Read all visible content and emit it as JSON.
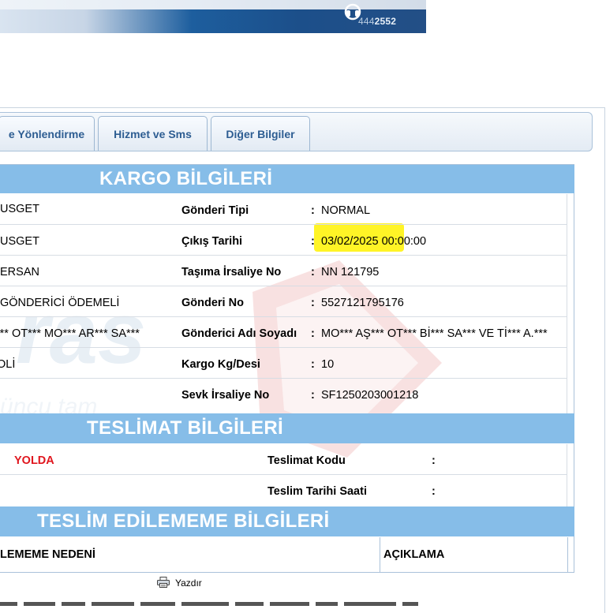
{
  "banner": {
    "phone_prefix": "444",
    "phone_suffix": "2552"
  },
  "tabs": [
    {
      "label": "e Yönlendirme"
    },
    {
      "label": "Hizmet ve Sms"
    },
    {
      "label": "Diğer Bilgiler"
    }
  ],
  "kargo": {
    "title": "KARGO BİLGİLERİ",
    "rows": [
      {
        "left": "USGET",
        "label": "Gönderi Tipi",
        "value": "NORMAL"
      },
      {
        "left": "USGET",
        "label": "Çıkış Tarihi",
        "value": "03/02/2025 00:00:00"
      },
      {
        "left": "ERSAN",
        "label": "Taşıma İrsaliye No",
        "value": "NN 121795"
      },
      {
        "left": "GÖNDERİCİ ÖDEMELİ",
        "label": "Gönderi No",
        "value": "5527121795176"
      },
      {
        "left": "*** OT*** MO*** AR*** SA***",
        "label": "Gönderici Adı Soyadı",
        "value": "MO*** AŞ*** OT*** Bİ*** SA*** VE Tİ*** A.***"
      },
      {
        "left": "OLİ",
        "label": "Kargo Kg/Desi",
        "value": "10"
      },
      {
        "left": "",
        "label": "Sevk İrsaliye No",
        "value": "SF1250203001218"
      }
    ],
    "colon": ":"
  },
  "teslimat": {
    "title": "TESLİMAT BİLGİLERİ",
    "status": "YOLDA",
    "code_label": "Teslimat Kodu",
    "date_label": "Teslim Tarihi Saati",
    "colon": ":"
  },
  "edilememe": {
    "title": "TESLİM EDİLEMEME BİLGİLERİ",
    "reason_header": "LEMEME NEDENİ",
    "desc_header": "AÇIKLAMA"
  },
  "print_label": "Yazdır",
  "colors": {
    "section_header": "#86bde8",
    "tab_text": "#2d5d92",
    "status": "#e0161e",
    "highlight": "#fff200"
  }
}
